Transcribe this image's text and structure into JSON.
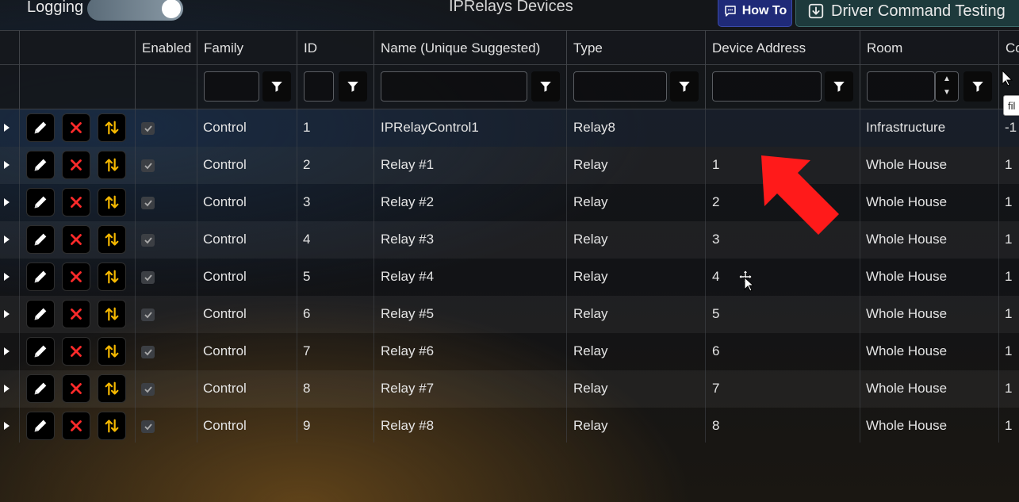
{
  "topbar": {
    "logging_label": "Logging",
    "page_title": "IPRelays Devices",
    "howto_label": "How To",
    "driver_command_label": "Driver Command Testing"
  },
  "grid": {
    "columns": [
      "Enabled",
      "Family",
      "ID",
      "Name (Unique Suggested)",
      "Type",
      "Device Address",
      "Room",
      "Co"
    ],
    "tooltip": "fil",
    "rows": [
      {
        "family": "Control",
        "id": "1",
        "name": "IPRelayControl1",
        "type": "Relay8",
        "address": "",
        "room": "Infrastructure",
        "extra": "-1"
      },
      {
        "family": "Control",
        "id": "2",
        "name": "Relay #1",
        "type": "Relay",
        "address": "1",
        "room": "Whole House",
        "extra": "1"
      },
      {
        "family": "Control",
        "id": "3",
        "name": "Relay #2",
        "type": "Relay",
        "address": "2",
        "room": "Whole House",
        "extra": "1"
      },
      {
        "family": "Control",
        "id": "4",
        "name": "Relay #3",
        "type": "Relay",
        "address": "3",
        "room": "Whole House",
        "extra": "1"
      },
      {
        "family": "Control",
        "id": "5",
        "name": "Relay #4",
        "type": "Relay",
        "address": "4",
        "room": "Whole House",
        "extra": "1"
      },
      {
        "family": "Control",
        "id": "6",
        "name": "Relay #5",
        "type": "Relay",
        "address": "5",
        "room": "Whole House",
        "extra": "1"
      },
      {
        "family": "Control",
        "id": "7",
        "name": "Relay #6",
        "type": "Relay",
        "address": "6",
        "room": "Whole House",
        "extra": "1"
      },
      {
        "family": "Control",
        "id": "8",
        "name": "Relay #7",
        "type": "Relay",
        "address": "7",
        "room": "Whole House",
        "extra": "1"
      },
      {
        "family": "Control",
        "id": "9",
        "name": "Relay #8",
        "type": "Relay",
        "address": "8",
        "room": "Whole House",
        "extra": "1"
      }
    ]
  },
  "colors": {
    "accent_arrow": "#ff1a1a",
    "delete_icon": "#ff2a2a",
    "move_icon": "#f5b800",
    "howto_bg": "#1f2a78",
    "driver_bg": "#1d3a3c"
  },
  "icons": {
    "edit": "pencil-icon",
    "delete": "close-icon",
    "move": "swap-vertical-icon",
    "filter": "filter-icon",
    "howto": "chat-icon",
    "driver": "download-icon"
  }
}
